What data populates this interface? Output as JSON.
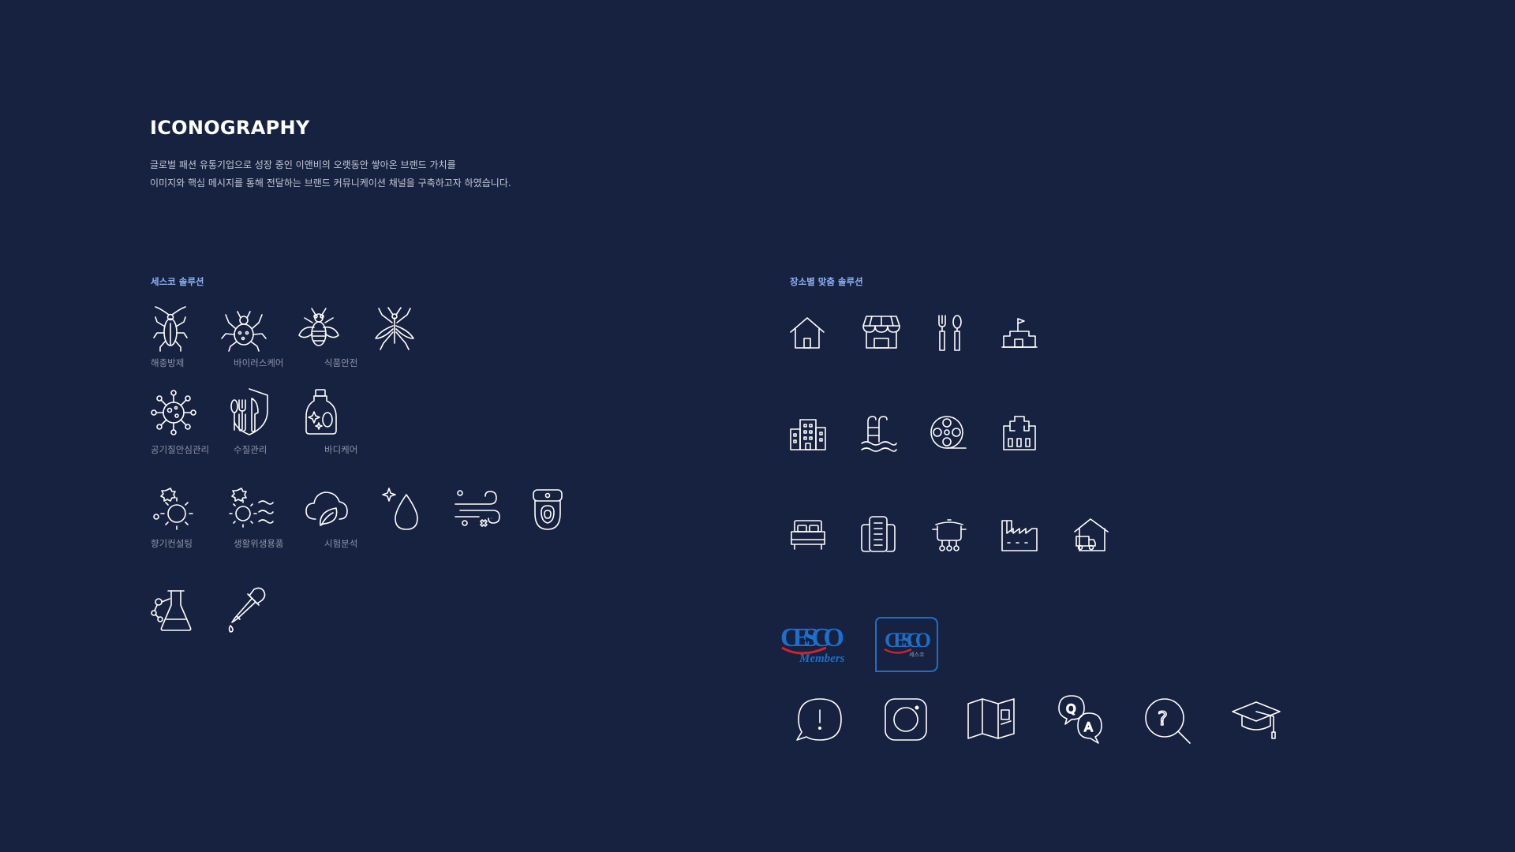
{
  "header": {
    "title": "ICONOGRAPHY",
    "desc_line1": "글로벌 패션 유통기업으로 성장 중인 이앤비의 오랫동안 쌓아온 브랜드 가치를",
    "desc_line2": "이미지와 핵심 메시지를 통해 전달하는 브랜드 커뮤니케이션 채널을 구축하고자 하였습니다."
  },
  "left_section": {
    "label": "세스코 솔루션",
    "labels": {
      "pest": "해충방제",
      "virus": "바이러스케어",
      "food": "식품안전",
      "air": "공기질안심관리",
      "water": "수질관리",
      "body": "바디케어",
      "scent": "향기컨설팅",
      "hygiene": "생활위생용품",
      "test": "시험분석"
    },
    "icons": [
      "cockroach-icon",
      "tick-icon",
      "fly-icon",
      "mosquito-icon",
      "virus-icon",
      "shield-utensils-icon",
      "bottle-icon",
      "sun-gear-icon",
      "sun-wave-icon",
      "cloud-leaf-icon",
      "droplet-icon",
      "wind-icon",
      "toilet-icon",
      "flask-icon",
      "dropper-icon"
    ]
  },
  "right_section": {
    "label": "장소별 맞춤 솔루션",
    "icons": [
      "house-icon",
      "store-icon",
      "restaurant-icon",
      "school-icon",
      "office-building-icon",
      "pool-icon",
      "film-reel-icon",
      "hospital-icon",
      "hotel-bed-icon",
      "apartment-icon",
      "kitchen-pot-icon",
      "factory-icon",
      "warehouse-truck-icon"
    ],
    "logos": {
      "members_word": "CESCO",
      "members_sub": "Members",
      "app_word": "CESCO",
      "app_sub": "세스코"
    },
    "bottom_icons": [
      "notice-bubble-icon",
      "instagram-icon",
      "brochure-icon",
      "qa-icon",
      "faq-search-icon",
      "graduation-cap-icon"
    ]
  },
  "colors": {
    "background": "#172140",
    "icon_stroke": "#ffffff",
    "section_label": "#8fb1f0",
    "caption": "#8d95a8",
    "logo_blue": "#1d6fc9",
    "logo_red": "#d2232a"
  }
}
